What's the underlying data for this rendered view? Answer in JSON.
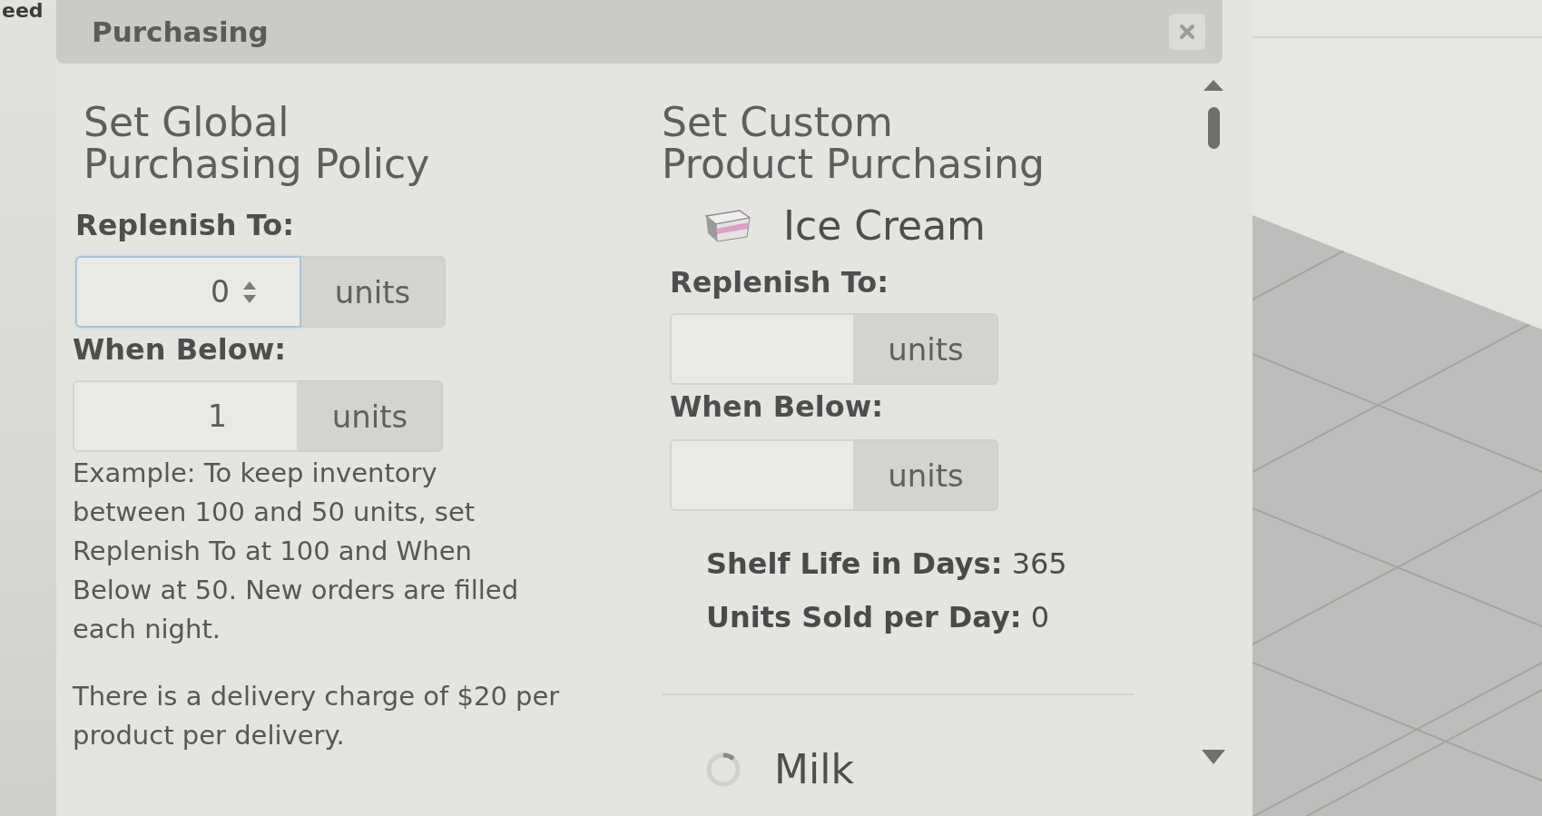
{
  "backdrop": {
    "corner_text": "eed"
  },
  "window": {
    "title": "Purchasing"
  },
  "global_policy": {
    "heading": "Set Global\nPurchasing Policy",
    "fields": [
      {
        "label": "Replenish To:",
        "value": "0",
        "unit": "units",
        "focused": true
      },
      {
        "label": "When Below:",
        "value": "1",
        "unit": "units",
        "focused": false
      }
    ],
    "notes": [
      "Example: To keep inventory between 100 and 50 units, set Replenish To at 100 and When Below at 50. New orders are filled each night.",
      "There is a delivery charge of $20 per product per delivery."
    ]
  },
  "custom_purchasing": {
    "heading": "Set Custom\nProduct Purchasing",
    "products": [
      {
        "name": "Ice Cream",
        "fields": [
          {
            "label": "Replenish To:",
            "unit": "units",
            "focused": false
          },
          {
            "label": "When Below:",
            "unit": "units",
            "focused": false
          }
        ],
        "stats": [
          {
            "label": "Shelf Life in Days:",
            "value": "365"
          },
          {
            "label": "Units Sold per Day:",
            "value": "0"
          }
        ]
      },
      {
        "name": "Milk"
      }
    ]
  }
}
